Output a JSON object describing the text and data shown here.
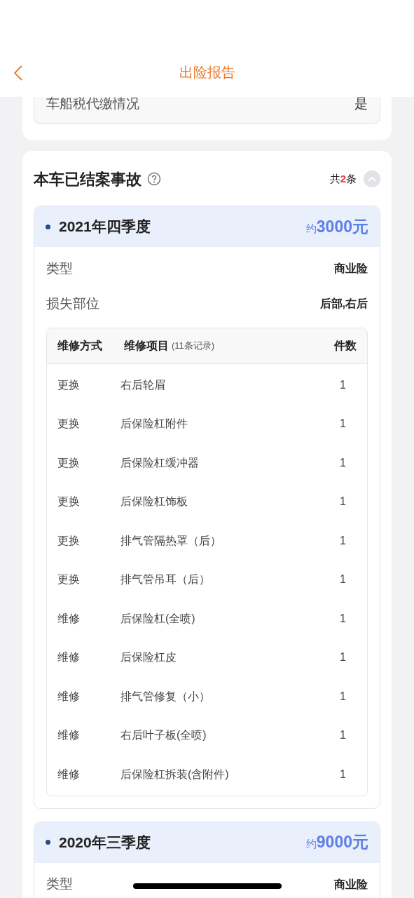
{
  "header": {
    "title": "出险报告"
  },
  "prev_card": {
    "rows": [
      {
        "label": "车船税代缴情况",
        "value": "是"
      }
    ]
  },
  "section": {
    "title": "本车已结案事故",
    "total_prefix": "共",
    "total_count": "2",
    "total_suffix": "条",
    "expanded": true
  },
  "accidents": [
    {
      "period": "2021年四季度",
      "amount_prefix": "约",
      "amount": "3000元",
      "details": [
        {
          "label": "类型",
          "value": "商业险"
        },
        {
          "label": "损失部位",
          "value": "后部,右后"
        }
      ],
      "table": {
        "columns": [
          "维修方式",
          "维修项目",
          "件数"
        ],
        "note": "(11条记录)",
        "rows": [
          [
            "更换",
            "右后轮眉",
            "1"
          ],
          [
            "更换",
            "后保险杠附件",
            "1"
          ],
          [
            "更换",
            "后保险杠缓冲器",
            "1"
          ],
          [
            "更换",
            "后保险杠饰板",
            "1"
          ],
          [
            "更换",
            "排气管隔热罩（后）",
            "1"
          ],
          [
            "更换",
            "排气管吊耳（后）",
            "1"
          ],
          [
            "维修",
            "后保险杠(全喷)",
            "1"
          ],
          [
            "维修",
            "后保险杠皮",
            "1"
          ],
          [
            "维修",
            "排气管修复（小）",
            "1"
          ],
          [
            "维修",
            "右后叶子板(全喷)",
            "1"
          ],
          [
            "维修",
            "后保险杠拆装(含附件)",
            "1"
          ]
        ]
      }
    },
    {
      "period": "2020年三季度",
      "amount_prefix": "约",
      "amount": "9000元",
      "details": [
        {
          "label": "类型",
          "value": "商业险"
        }
      ]
    }
  ]
}
